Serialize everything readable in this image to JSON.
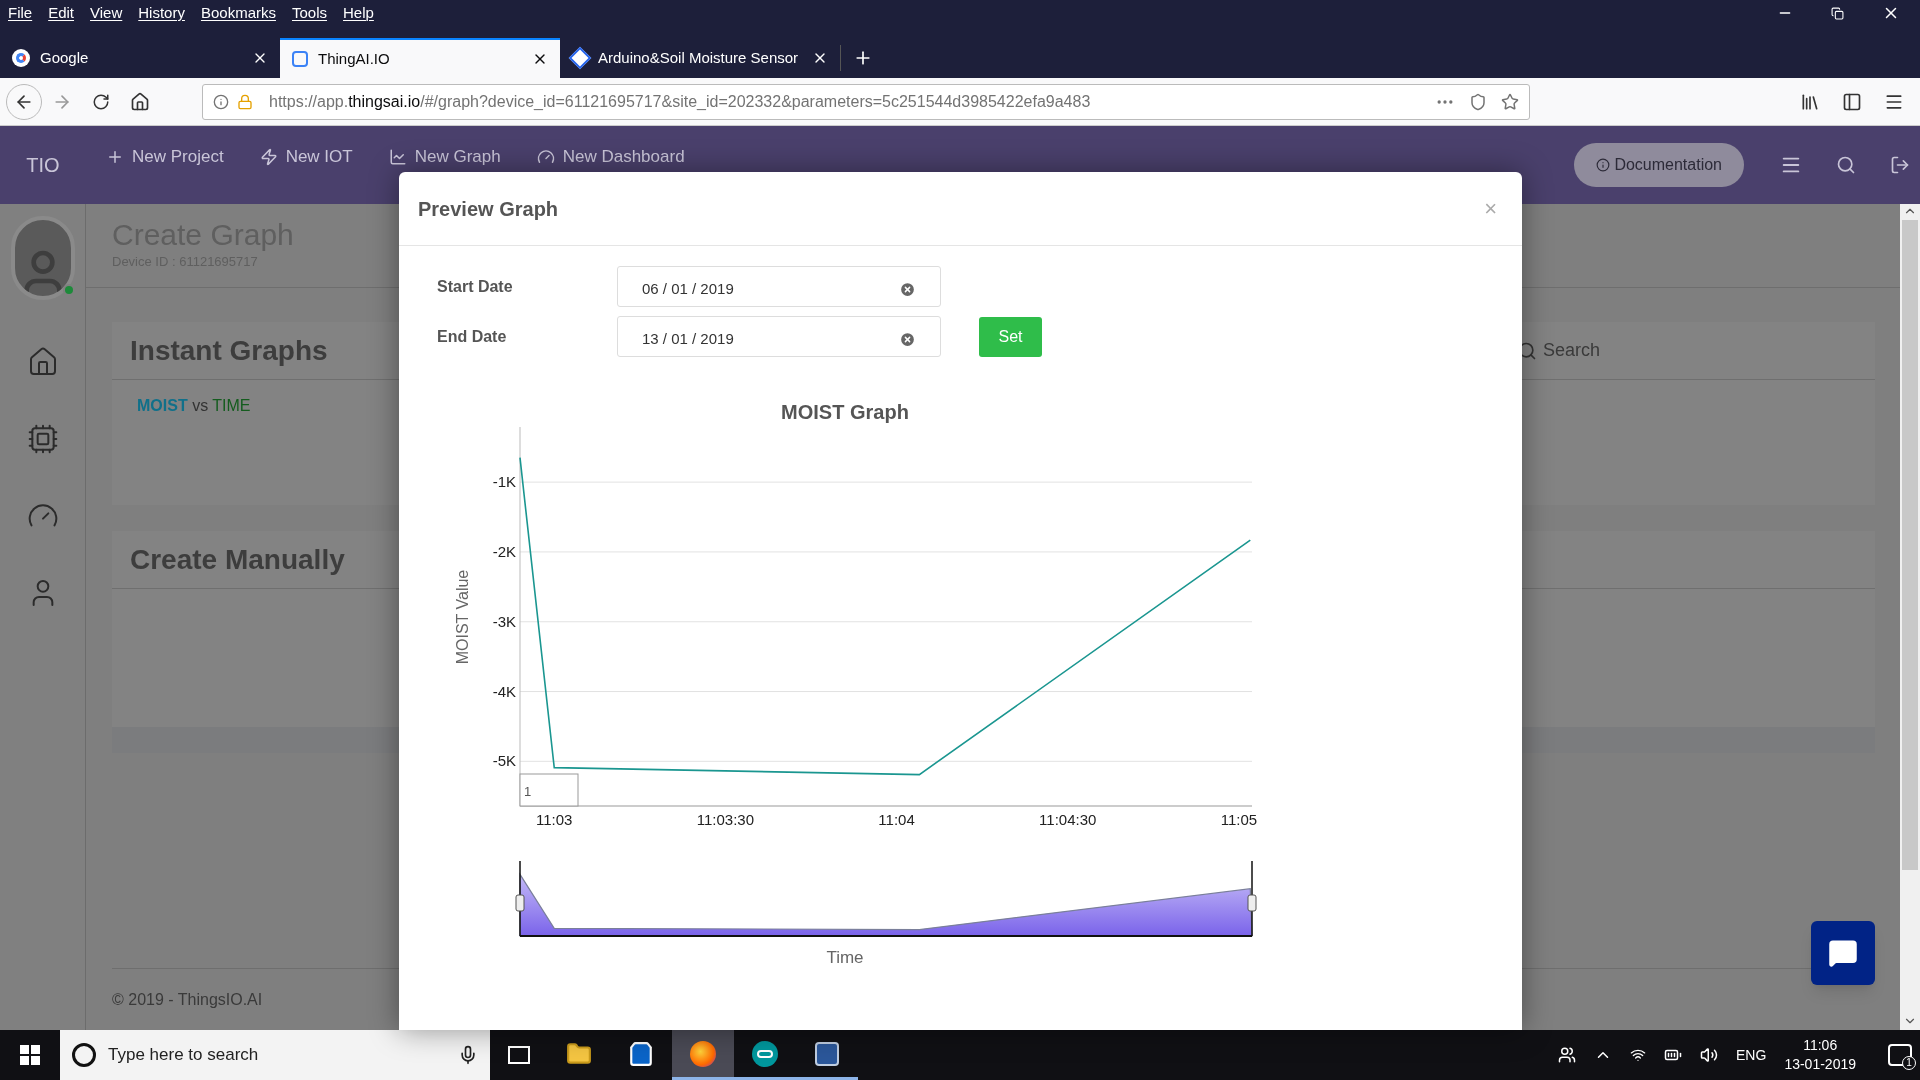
{
  "browser": {
    "menu": [
      "File",
      "Edit",
      "View",
      "History",
      "Bookmarks",
      "Tools",
      "Help"
    ],
    "tabs": [
      {
        "label": "Google",
        "selected": false
      },
      {
        "label": "ThingAI.IO",
        "selected": true
      },
      {
        "label": "Arduino&Soil Moisture Sensor",
        "selected": false
      }
    ],
    "url": "https://app.**thingsai.io**/#/graph?device_id=61121695717&site_id=202332&parameters=5c251544d3985422efa9a483"
  },
  "app_header": {
    "brand": "TIO",
    "nav": [
      "New Project",
      "New IOT",
      "New Graph",
      "New Dashboard"
    ],
    "documentation_button": "Documentation"
  },
  "sidebar": {
    "online": true
  },
  "page": {
    "title": "Create Graph",
    "device_id": "Device ID : 61121695717",
    "instant_graphs": {
      "title": "Instant Graphs",
      "link": {
        "parameter": "MOIST",
        "joiner": "vs",
        "axis": "TIME"
      },
      "search_placeholder": "Search"
    },
    "create_manually": {
      "title": "Create Manually"
    },
    "footer": "© 2019 - ThingsIO.AI"
  },
  "modal": {
    "title": "Preview Graph",
    "close": "×",
    "start_date": {
      "label": "Start Date",
      "value": "06 / 01 / 2019"
    },
    "end_date": {
      "label": "End Date",
      "value": "13 / 01 / 2019"
    },
    "set_button": "Set",
    "range_box": "1",
    "chart_data": {
      "type": "line",
      "title": "MOIST Graph",
      "ylabel": "MOIST Value",
      "grid": true,
      "annotations": [
        {
          "text": "Time"
        }
      ],
      "x": [
        39774,
        39780,
        39844,
        39902
      ],
      "series": [
        {
          "color": "#1a9690",
          "values": [
            -650,
            -5090,
            -5190,
            -1830
          ]
        }
      ],
      "xlim": [
        39774,
        39902.3
      ],
      "ylim": [
        -5640,
        -210
      ],
      "xticks": [
        {
          "value": 39780,
          "label": "11:03"
        },
        {
          "value": 39810,
          "label": "11:03:30"
        },
        {
          "value": 39840,
          "label": "11:04"
        },
        {
          "value": 39870,
          "label": "11:04:30"
        },
        {
          "value": 39900,
          "label": "11:05"
        }
      ],
      "yticks": [
        {
          "value": -1000,
          "label": "-1K"
        },
        {
          "value": -2000,
          "label": "-2K"
        },
        {
          "value": -3000,
          "label": "-3K"
        },
        {
          "value": -4000,
          "label": "-4K"
        },
        {
          "value": -5000,
          "label": "-5K"
        }
      ]
    }
  },
  "taskbar": {
    "search_placeholder": "Type here to search",
    "apps": [
      {
        "selected": false,
        "open": false
      },
      {
        "selected": false,
        "open": false
      },
      {
        "selected": true,
        "open": true
      },
      {
        "selected": false,
        "open": true
      },
      {
        "selected": false,
        "open": true
      }
    ],
    "language": "ENG",
    "time": "11:06",
    "date": "13-01-2019",
    "notifications": "1"
  }
}
